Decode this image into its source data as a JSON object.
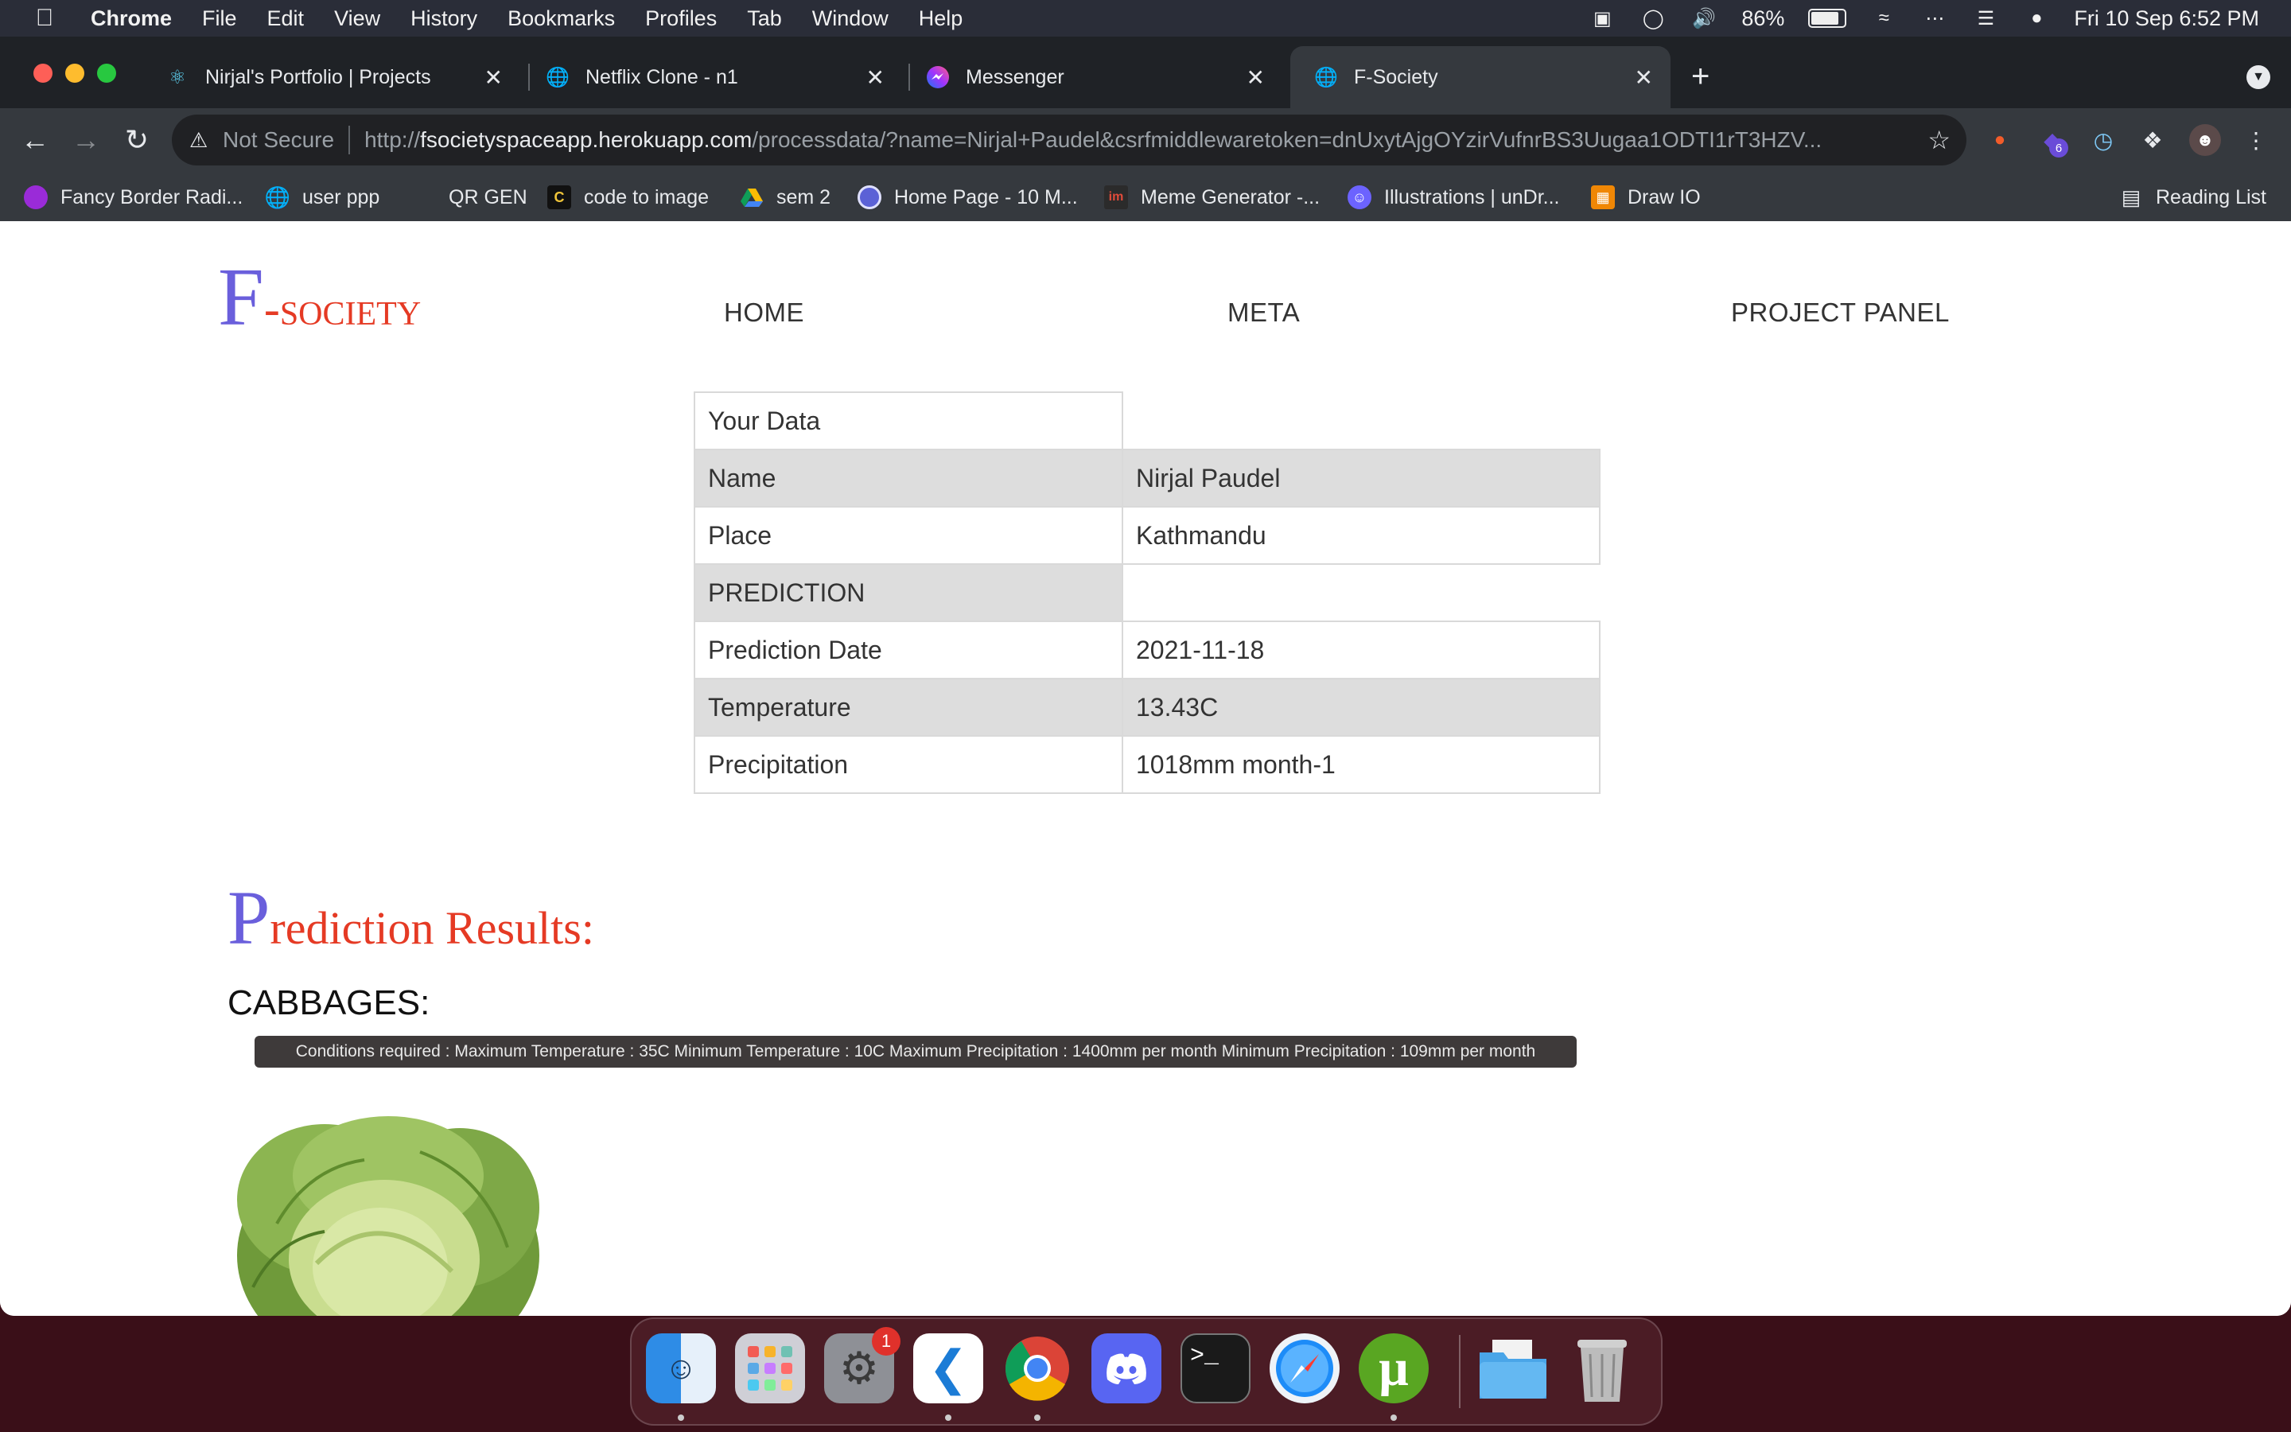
{
  "menubar": {
    "app": "Chrome",
    "items": [
      "File",
      "Edit",
      "View",
      "History",
      "Bookmarks",
      "Profiles",
      "Tab",
      "Window",
      "Help"
    ],
    "battery": "86%",
    "datetime": "Fri 10 Sep  6:52 PM"
  },
  "tabs": [
    {
      "title": "Nirjal's Portfolio | Projects",
      "icon": "react-icon"
    },
    {
      "title": "Netflix Clone - n1",
      "icon": "globe-icon"
    },
    {
      "title": "Messenger",
      "icon": "messenger-icon"
    },
    {
      "title": "F-Society",
      "icon": "globe-icon",
      "active": true
    }
  ],
  "omnibox": {
    "security": "Not Secure",
    "url_prefix": "http://",
    "url_host": "fsocietyspaceapp.herokuapp.com",
    "url_path": "/processdata/?name=Nirjal+Paudel&csrfmiddlewaretoken=dnUxytAjgOYzirVufnrBS3Uugaa1ODTI1rT3HZV..."
  },
  "bookmarks": [
    {
      "label": "Fancy Border Radi...",
      "icon": "purple-blob-icon"
    },
    {
      "label": "user ppp",
      "icon": "globe-icon"
    },
    {
      "label": "QR GEN",
      "icon": ""
    },
    {
      "label": "code to image",
      "icon": "carbon-icon"
    },
    {
      "label": "sem 2",
      "icon": "drive-icon"
    },
    {
      "label": "Home Page - 10 M...",
      "icon": "circle-icon"
    },
    {
      "label": "Meme Generator -...",
      "icon": "imgflip-icon"
    },
    {
      "label": "Illustrations | unDr...",
      "icon": "undraw-icon"
    },
    {
      "label": "Draw IO",
      "icon": "drawio-icon"
    }
  ],
  "reading_list": "Reading List",
  "site": {
    "logo_first": "F",
    "logo_rest": "-society",
    "nav": [
      "HOME",
      "META",
      "PROJECT PANEL"
    ]
  },
  "table": {
    "header": "Your Data",
    "name_label": "Name",
    "name_value": "Nirjal Paudel",
    "place_label": "Place",
    "place_value": "Kathmandu",
    "prediction_label": "PREDICTION",
    "date_label": "Prediction Date",
    "date_value": "2021-11-18",
    "temp_label": "Temperature",
    "temp_value": "13.43C",
    "precip_label": "Precipitation",
    "precip_value": "1018mm month-1"
  },
  "results": {
    "title_first": "P",
    "title_rest": "rediction Results:",
    "crop": "CABBAGES:",
    "conditions": "Conditions required : Maximum Temperature : 35C Minimum Temperature : 10C Maximum Precipitation : 1400mm per month Minimum Precipitation : 109mm per month"
  },
  "dock": {
    "apps": [
      "Finder",
      "Launchpad",
      "System Preferences",
      "Visual Studio Code",
      "Google Chrome",
      "Discord",
      "Terminal",
      "Safari",
      "uTorrent",
      "Downloads",
      "Trash"
    ],
    "system_preferences_badge": "1",
    "extension_badge": "6"
  },
  "colors": {
    "logo_blue": "#6a5fdc",
    "logo_red": "#e53a24",
    "row_gray": "#dddddd"
  }
}
